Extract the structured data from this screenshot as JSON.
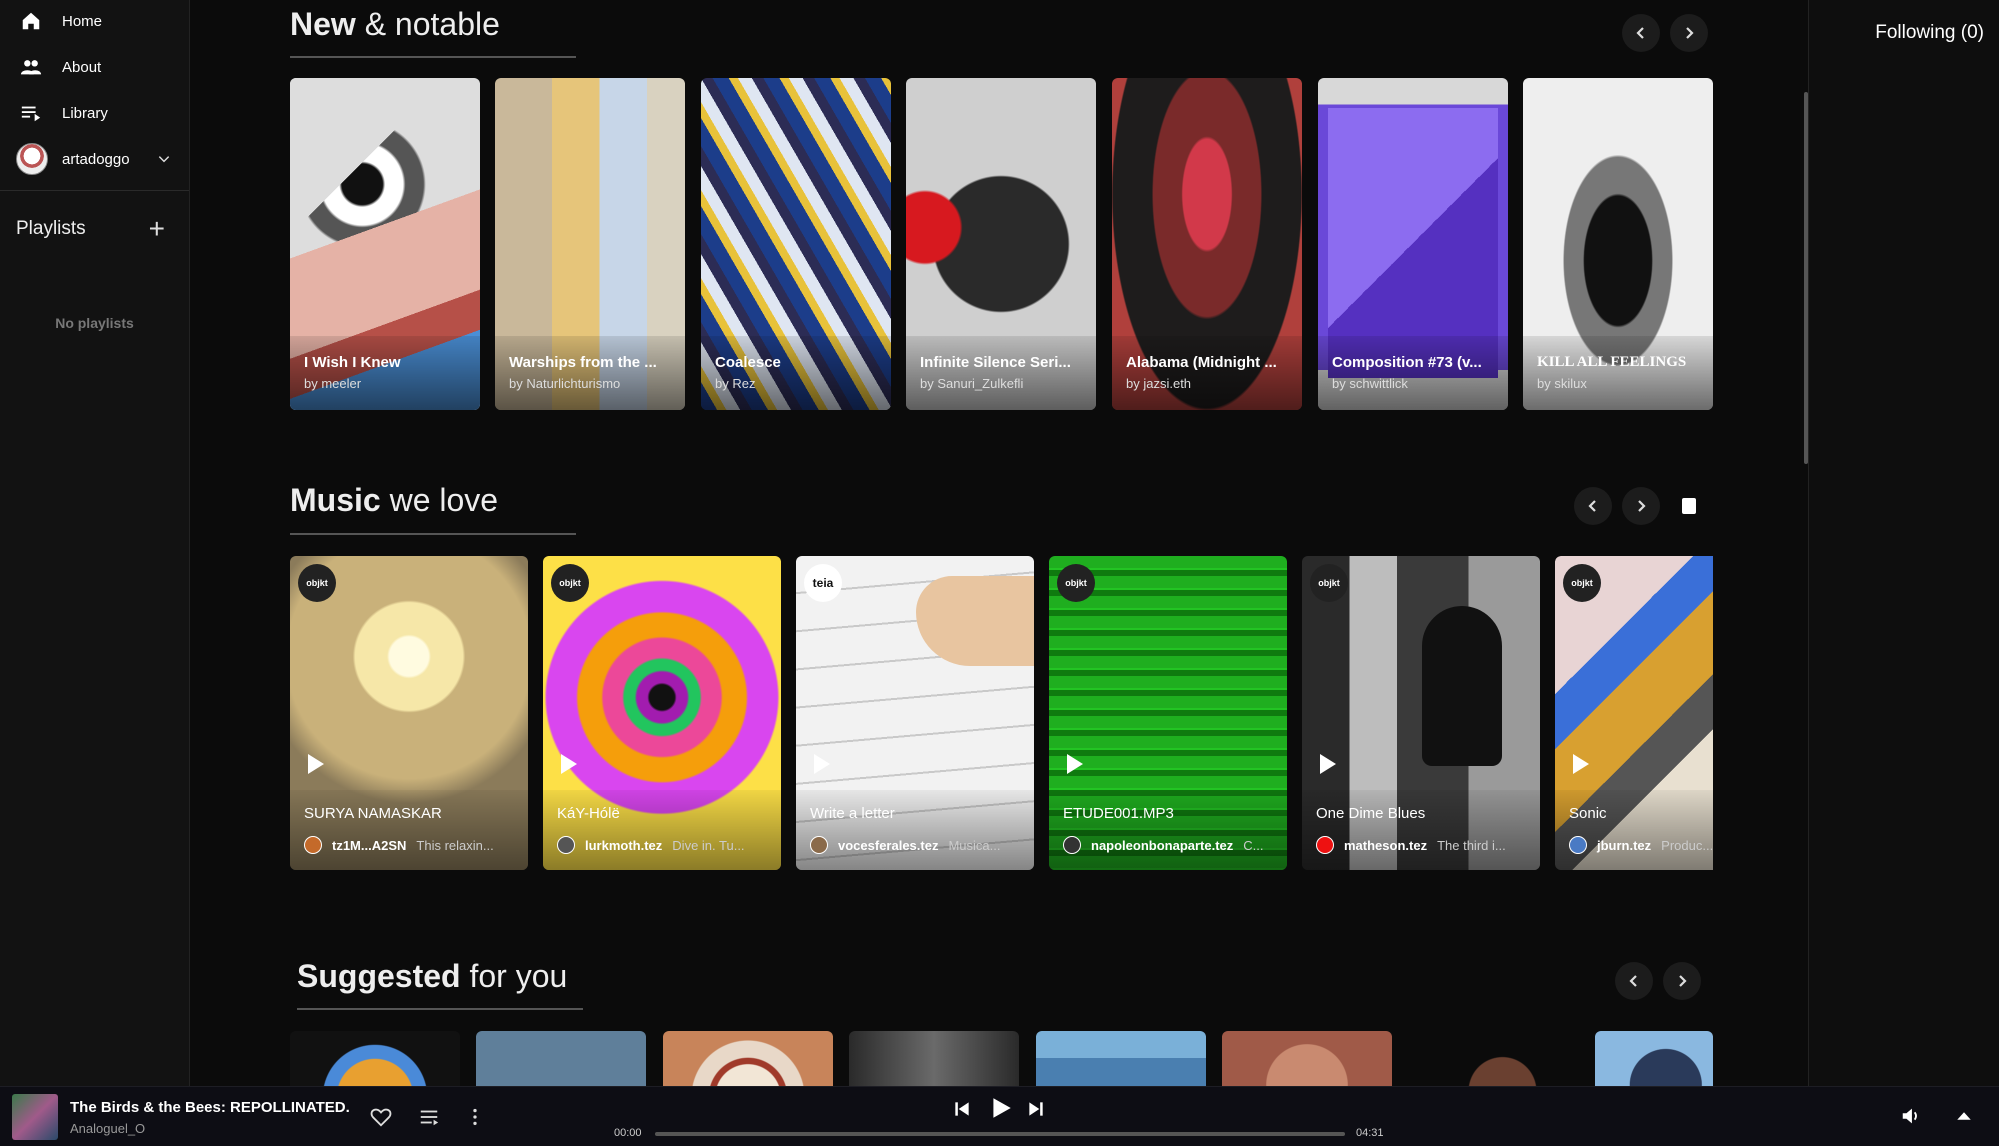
{
  "sidebar": {
    "nav": [
      {
        "label": "Home",
        "icon": "home-icon"
      },
      {
        "label": "About",
        "icon": "people-icon"
      },
      {
        "label": "Library",
        "icon": "library-icon"
      }
    ],
    "user": {
      "name": "artadoggo"
    },
    "playlists_title": "Playlists",
    "no_playlists": "No playlists"
  },
  "right_rail": {
    "following": "Following (0)"
  },
  "sections": {
    "new": {
      "bold": "New",
      "rest": " & notable",
      "cards": [
        {
          "title": "I Wish I Knew",
          "artist": "by meeler"
        },
        {
          "title": "Warships from the ...",
          "artist": "by Naturlichturismo"
        },
        {
          "title": "Coalesce",
          "artist": "by Rez"
        },
        {
          "title": "Infinite Silence Seri...",
          "artist": "by Sanuri_Zulkefli"
        },
        {
          "title": "Alabama (Midnight ...",
          "artist": "by jazsi.eth"
        },
        {
          "title": "Composition #73 (v...",
          "artist": "by schwittlick"
        },
        {
          "title": "KILL ALL FEELINGS",
          "artist": "by skilux"
        }
      ]
    },
    "music": {
      "bold": "Music",
      "rest": " we love",
      "cards": [
        {
          "badge": "objkt",
          "title": "SURYA NAMASKAR",
          "user": "tz1M...A2SN",
          "desc": "This relaxin..."
        },
        {
          "badge": "objkt",
          "title": "KáY-Hólë",
          "user": "lurkmoth.tez",
          "desc": "Dive in. Tu..."
        },
        {
          "badge": "teia",
          "title": "Write a letter",
          "user": "vocesferales.tez",
          "desc": "Musica..."
        },
        {
          "badge": "objkt",
          "title": "ETUDE001.MP3",
          "user": "napoleonbonaparte.tez",
          "desc": "C..."
        },
        {
          "badge": "objkt",
          "title": "One Dime Blues",
          "user": "matheson.tez",
          "desc": "The third i..."
        },
        {
          "badge": "objkt",
          "title": "Sonic",
          "user": "jburn.tez",
          "desc": "Produc..."
        }
      ]
    },
    "suggested": {
      "bold": "Suggested",
      "rest": " for you"
    }
  },
  "player": {
    "title": "The Birds & the Bees: REPOLLINATED.",
    "artist": "Analoguel_O",
    "time_current": "00:00",
    "time_total": "04:31",
    "progress": 0
  }
}
